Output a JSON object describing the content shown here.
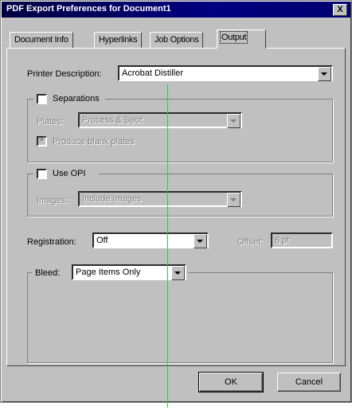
{
  "window": {
    "title": "PDF Export Preferences for Document1",
    "close_glyph": "X"
  },
  "tabs": [
    {
      "label": "Document Info",
      "active": false
    },
    {
      "label": "Hyperlinks",
      "active": false
    },
    {
      "label": "Job Options",
      "active": false
    },
    {
      "label": "Output",
      "active": true
    }
  ],
  "printer": {
    "label": "Printer Description:",
    "value": "Acrobat Distiller"
  },
  "separations": {
    "checkbox_label": "Separations",
    "checked": false,
    "plates_label": "Plates:",
    "plates_value": "Process & Spot",
    "produce_blank_label": "Produce blank plates",
    "produce_blank_checked": true
  },
  "opi": {
    "checkbox_label": "Use OPI",
    "checked": false,
    "images_label": "Images:",
    "images_value": "Include Images"
  },
  "registration": {
    "label": "Registration:",
    "value": "Off",
    "offset_label": "Offset:",
    "offset_value": "6 pt"
  },
  "bleed": {
    "label": "Bleed:",
    "value": "Page Items Only"
  },
  "buttons": {
    "ok": "OK",
    "cancel": "Cancel"
  },
  "colors": {
    "title_bar": "#000080",
    "face": "#c0c0c0",
    "guide_line": "#2ecc40"
  }
}
